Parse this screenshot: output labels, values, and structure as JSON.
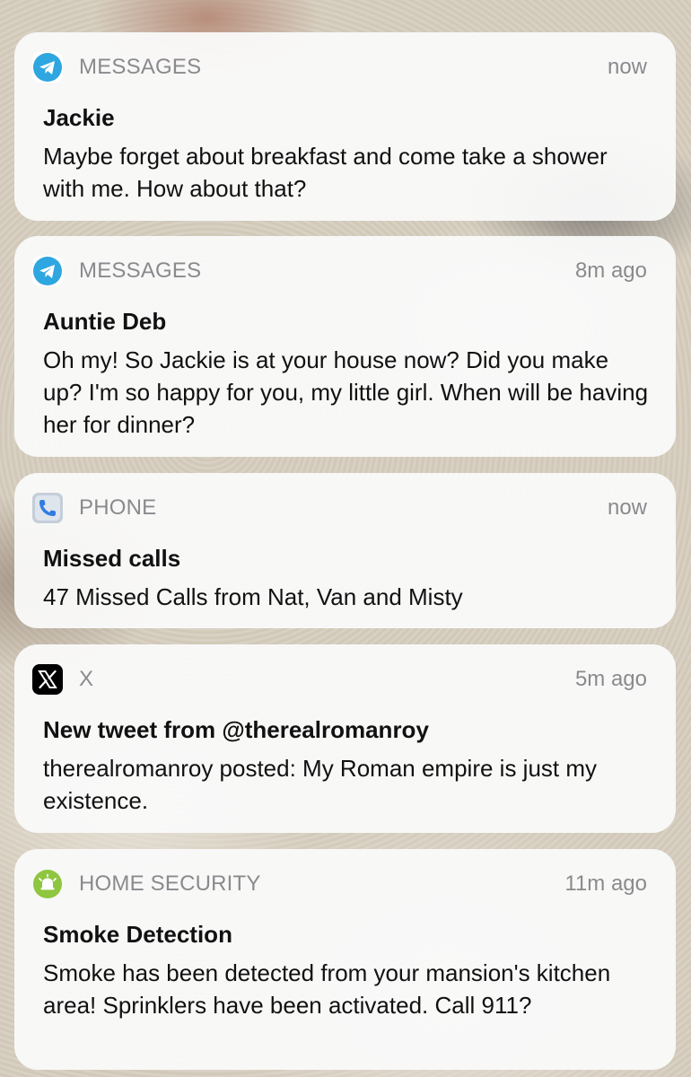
{
  "notifications": [
    {
      "app": "MESSAGES",
      "icon": "telegram-icon",
      "time": "now",
      "title": "Jackie",
      "body": "Maybe forget about breakfast and come take a shower with me. How about that?"
    },
    {
      "app": "MESSAGES",
      "icon": "telegram-icon",
      "time": "8m ago",
      "title": "Auntie Deb",
      "body": "Oh my! So Jackie is at your house now? Did you make up? I'm so happy for you, my little girl. When will be having her for dinner?"
    },
    {
      "app": "PHONE",
      "icon": "phone-icon",
      "time": "now",
      "title": "Missed calls",
      "body": "47 Missed Calls from Nat, Van and Misty"
    },
    {
      "app": "X",
      "icon": "x-logo-icon",
      "time": "5m ago",
      "title": "New tweet from @therealromanroy",
      "body": "therealromanroy posted: My Roman empire is just my existence."
    },
    {
      "app": "HOME SECURITY",
      "icon": "alarm-bell-icon",
      "time": "11m ago",
      "title": "Smoke Detection",
      "body": "Smoke has been detected from your mansion's kitchen area! Sprinklers have been activated. Call 911?"
    }
  ],
  "colors": {
    "telegram": "#2ea6e0",
    "phone_icon_bg": "#9aa9b8",
    "x_bg": "#000000",
    "security": "#8fc63f"
  }
}
